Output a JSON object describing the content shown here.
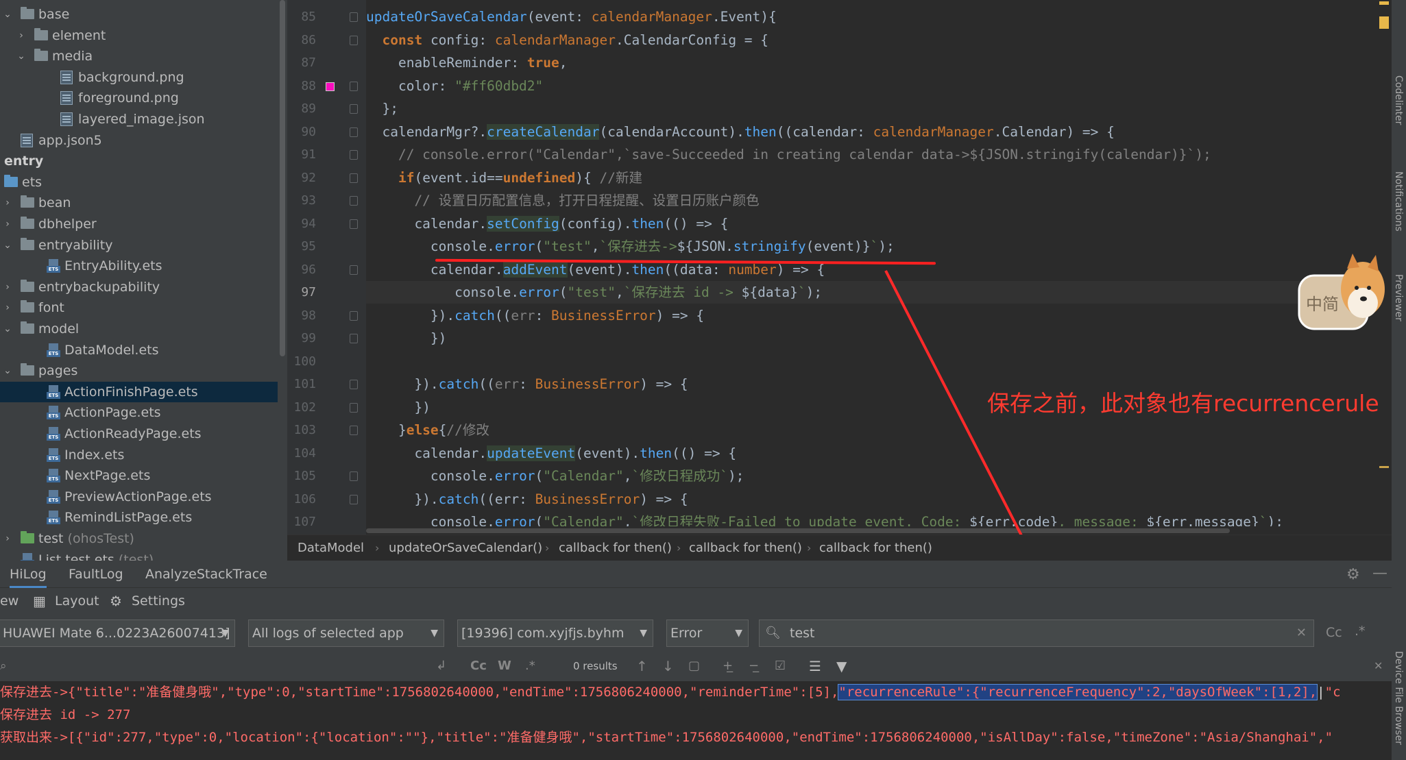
{
  "tree": [
    {
      "label": "base",
      "indent": 0,
      "arrow": "down",
      "icon": "folder"
    },
    {
      "label": "element",
      "indent": 1,
      "arrow": "right",
      "icon": "folder"
    },
    {
      "label": "media",
      "indent": 1,
      "arrow": "down",
      "icon": "folder"
    },
    {
      "label": "background.png",
      "indent": 3,
      "arrow": "",
      "icon": "image"
    },
    {
      "label": "foreground.png",
      "indent": 3,
      "arrow": "",
      "icon": "image"
    },
    {
      "label": "layered_image.json",
      "indent": 3,
      "arrow": "",
      "icon": "json"
    },
    {
      "label": "app.json5",
      "indent": 0,
      "arrow": "",
      "icon": "json"
    },
    {
      "label": "entry",
      "indent": -1,
      "arrow": "",
      "icon": "none",
      "bold": true
    },
    {
      "label": "ets",
      "indent": -1,
      "arrow": "",
      "icon": "folder-blue"
    },
    {
      "label": "bean",
      "indent": 0,
      "arrow": "right",
      "icon": "folder"
    },
    {
      "label": "dbhelper",
      "indent": 0,
      "arrow": "right",
      "icon": "folder"
    },
    {
      "label": "entryability",
      "indent": 0,
      "arrow": "down",
      "icon": "folder"
    },
    {
      "label": "EntryAbility.ets",
      "indent": 2,
      "arrow": "",
      "icon": "ets"
    },
    {
      "label": "entrybackupability",
      "indent": 0,
      "arrow": "right",
      "icon": "folder"
    },
    {
      "label": "font",
      "indent": 0,
      "arrow": "right",
      "icon": "folder"
    },
    {
      "label": "model",
      "indent": 0,
      "arrow": "down",
      "icon": "folder"
    },
    {
      "label": "DataModel.ets",
      "indent": 2,
      "arrow": "",
      "icon": "ets"
    },
    {
      "label": "pages",
      "indent": 0,
      "arrow": "down",
      "icon": "folder"
    },
    {
      "label": "ActionFinishPage.ets",
      "indent": 2,
      "arrow": "",
      "icon": "ets",
      "selected": true
    },
    {
      "label": "ActionPage.ets",
      "indent": 2,
      "arrow": "",
      "icon": "ets"
    },
    {
      "label": "ActionReadyPage.ets",
      "indent": 2,
      "arrow": "",
      "icon": "ets"
    },
    {
      "label": "Index.ets",
      "indent": 2,
      "arrow": "",
      "icon": "ets"
    },
    {
      "label": "NextPage.ets",
      "indent": 2,
      "arrow": "",
      "icon": "ets"
    },
    {
      "label": "PreviewActionPage.ets",
      "indent": 2,
      "arrow": "",
      "icon": "ets"
    },
    {
      "label": "RemindListPage.ets",
      "indent": 2,
      "arrow": "",
      "icon": "ets"
    },
    {
      "label": "test",
      "suffix": " (ohosTest)",
      "indent": 0,
      "arrow": "right",
      "icon": "folder-green"
    },
    {
      "label": "List.test.ets",
      "suffix": " (test)",
      "indent": 0,
      "arrow": "",
      "icon": "ets"
    }
  ],
  "editor": {
    "line_numbers": [
      "85",
      "86",
      "87",
      "88",
      "89",
      "90",
      "91",
      "92",
      "93",
      "94",
      "95",
      "96",
      "97",
      "98",
      "99",
      "100",
      "101",
      "102",
      "103",
      "104",
      "105",
      "106",
      "107"
    ],
    "current_line": "97",
    "lines": [
      [
        [
          "f",
          "updateOrSaveCalendar"
        ],
        [
          "pl",
          "(event: "
        ],
        [
          "ttype",
          "calendarManager"
        ],
        [
          "pl",
          ".Event){"
        ]
      ],
      [
        [
          "pl",
          "  "
        ],
        [
          "k",
          "const "
        ],
        [
          "pl",
          "config: "
        ],
        [
          "ttype",
          "calendarManager"
        ],
        [
          "pl",
          ".CalendarConfig = {"
        ]
      ],
      [
        [
          "pl",
          "    enableReminder: "
        ],
        [
          "k",
          "true"
        ],
        [
          "pl",
          ","
        ]
      ],
      [
        [
          "pl",
          "    color: "
        ],
        [
          "s",
          "\"#ff60dbd2\""
        ]
      ],
      [
        [
          "pl",
          "  };"
        ]
      ],
      [
        [
          "pl",
          "  calendarMgr?."
        ],
        [
          "fh",
          "createCalendar"
        ],
        [
          "pl",
          "(calendarAccount)."
        ],
        [
          "f",
          "then"
        ],
        [
          "pl",
          "((calendar: "
        ],
        [
          "ttype",
          "calendarManager"
        ],
        [
          "pl",
          ".Calendar) => {"
        ]
      ],
      [
        [
          "c",
          "    // console.error(\"Calendar\",`save-Succeeded in creating calendar data->${JSON.stringify(calendar)}`);"
        ]
      ],
      [
        [
          "pl",
          "    "
        ],
        [
          "k",
          "if"
        ],
        [
          "pl",
          "(event.id=="
        ],
        [
          "k",
          "undefined"
        ],
        [
          "pl",
          "){ "
        ],
        [
          "c",
          "//新建"
        ]
      ],
      [
        [
          "c",
          "      // 设置日历配置信息，打开日程提醒、设置日历账户颜色"
        ]
      ],
      [
        [
          "pl",
          "      calendar."
        ],
        [
          "fh",
          "setConfig"
        ],
        [
          "pl",
          "(config)."
        ],
        [
          "f",
          "then"
        ],
        [
          "pl",
          "(() => {"
        ]
      ],
      [
        [
          "pl",
          "        console."
        ],
        [
          "f",
          "error"
        ],
        [
          "pl",
          "("
        ],
        [
          "s",
          "\"test\""
        ],
        [
          "pl",
          ","
        ],
        [
          "s",
          "`保存进去->"
        ],
        [
          "pl",
          "${JSON."
        ],
        [
          "f",
          "stringify"
        ],
        [
          "pl",
          "(event)}"
        ],
        [
          "s",
          "`"
        ],
        [
          "pl",
          ");"
        ]
      ],
      [
        [
          "pl",
          "        calendar."
        ],
        [
          "fh",
          "addEvent"
        ],
        [
          "pl",
          "(event)."
        ],
        [
          "f",
          "then"
        ],
        [
          "pl",
          "((data: "
        ],
        [
          "ttype",
          "number"
        ],
        [
          "pl",
          ") => {"
        ]
      ],
      [
        [
          "pl",
          "           console."
        ],
        [
          "f",
          "error"
        ],
        [
          "pl",
          "("
        ],
        [
          "s",
          "\"test\""
        ],
        [
          "pl",
          ","
        ],
        [
          "s",
          "`保存进去 id -> "
        ],
        [
          "pl",
          "${data}"
        ],
        [
          "s",
          "`"
        ],
        [
          "pl",
          ");"
        ]
      ],
      [
        [
          "pl",
          "        })."
        ],
        [
          "f",
          "catch"
        ],
        [
          "pl",
          "(("
        ],
        [
          "c",
          "err"
        ],
        [
          "pl",
          ": "
        ],
        [
          "ttype",
          "BusinessError"
        ],
        [
          "pl",
          ") => {"
        ]
      ],
      [
        [
          "pl",
          "        })"
        ]
      ],
      [
        [
          "pl",
          ""
        ]
      ],
      [
        [
          "pl",
          "      })."
        ],
        [
          "f",
          "catch"
        ],
        [
          "pl",
          "(("
        ],
        [
          "c",
          "err"
        ],
        [
          "pl",
          ": "
        ],
        [
          "ttype",
          "BusinessError"
        ],
        [
          "pl",
          ") => {"
        ]
      ],
      [
        [
          "pl",
          "      })"
        ]
      ],
      [
        [
          "pl",
          "    }"
        ],
        [
          "k",
          "else"
        ],
        [
          "pl",
          "{"
        ],
        [
          "c",
          "//修改"
        ]
      ],
      [
        [
          "pl",
          "      calendar."
        ],
        [
          "fh",
          "updateEvent"
        ],
        [
          "pl",
          "(event)."
        ],
        [
          "f",
          "then"
        ],
        [
          "pl",
          "(() => {"
        ]
      ],
      [
        [
          "pl",
          "        console."
        ],
        [
          "f",
          "error"
        ],
        [
          "pl",
          "("
        ],
        [
          "s",
          "\"Calendar\""
        ],
        [
          "pl",
          ","
        ],
        [
          "s",
          "`修改日程成功`"
        ],
        [
          "pl",
          ");"
        ]
      ],
      [
        [
          "pl",
          "      })."
        ],
        [
          "f",
          "catch"
        ],
        [
          "pl",
          "((err: "
        ],
        [
          "ttype",
          "BusinessError"
        ],
        [
          "pl",
          ") => {"
        ]
      ],
      [
        [
          "pl",
          "        console."
        ],
        [
          "f",
          "error"
        ],
        [
          "pl",
          "("
        ],
        [
          "s",
          "\"Calendar\""
        ],
        [
          "pl",
          ","
        ],
        [
          "s",
          "`修改日程失败-Failed to update event. Code: "
        ],
        [
          "pl",
          "${err.code}"
        ],
        [
          "s",
          ", message: "
        ],
        [
          "pl",
          "${err.message}"
        ],
        [
          "s",
          "`"
        ],
        [
          "pl",
          ");"
        ]
      ]
    ]
  },
  "annotation": "保存之前，此对象也有recurrencerule",
  "sticker_text": "中简",
  "breadcrumb": [
    "DataModel",
    "updateOrSaveCalendar()",
    "callback for then()",
    "callback for then()",
    "callback for then()"
  ],
  "panel": {
    "tabs": [
      "HiLog",
      "FaultLog",
      "AnalyzeStackTrace"
    ],
    "view_label": "ew",
    "layout_label": "Layout",
    "settings_label": "Settings",
    "device": "HUAWEI Mate 6...0223A26007413]",
    "log_scope": "All logs of selected app",
    "process": "[19396] com.xyjfjs.byhm",
    "level": "Error",
    "search_value": "test",
    "case_label": "Cc",
    "results": "0 results",
    "log_lines": [
      "保存进去->{\"title\":\"准备健身哦\",\"type\":0,\"startTime\":1756802640000,\"endTime\":1756806240000,\"reminderTime\":[5],",
      "保存进去 id -> 277",
      "获取出来->[{\"id\":277,\"type\":0,\"location\":{\"location\":\"\"},\"title\":\"准备健身哦\",\"startTime\":1756802640000,\"endTime\":1756806240000,\"isAllDay\":false,\"timeZone\":\"Asia/Shanghai\",\""
    ],
    "log_highlight": "\"recurrenceRule\":{\"recurrenceFrequency\":2,\"daysOfWeek\":[1,2],",
    "log_tail": "\"c"
  },
  "side_tabs": [
    "Codelinter",
    "Notifications",
    "Previewer",
    "Device File Browser"
  ],
  "colors": {
    "accent": "#4a88c7",
    "annotation": "#ff3b30",
    "log_error": "#ff6b68"
  }
}
